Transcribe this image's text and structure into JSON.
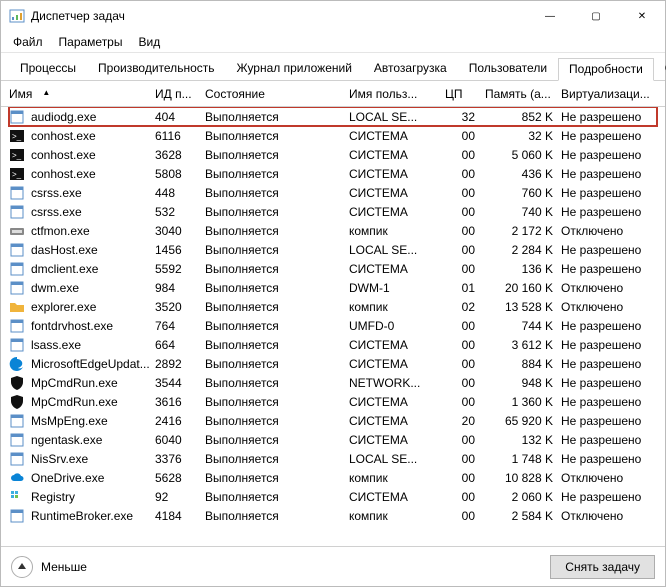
{
  "window": {
    "title": "Диспетчер задач",
    "controls": {
      "min": "—",
      "max": "▢",
      "close": "✕"
    }
  },
  "menu": {
    "items": [
      "Файл",
      "Параметры",
      "Вид"
    ]
  },
  "tabs": {
    "items": [
      "Процессы",
      "Производительность",
      "Журнал приложений",
      "Автозагрузка",
      "Пользователи",
      "Подробности",
      "Службы"
    ],
    "active_index": 5
  },
  "columns": {
    "name": "Имя",
    "pid": "ИД п...",
    "state": "Состояние",
    "user": "Имя польз...",
    "cpu": "ЦП",
    "mem": "Память (а...",
    "virt": "Виртуализаци..."
  },
  "rows": [
    {
      "icon": "app",
      "name": "audiodg.exe",
      "pid": "404",
      "state": "Выполняется",
      "user": "LOCAL SE...",
      "cpu": "32",
      "mem": "852 K",
      "virt": "Не разрешено",
      "hl": true
    },
    {
      "icon": "cmd",
      "name": "conhost.exe",
      "pid": "6116",
      "state": "Выполняется",
      "user": "СИСТЕМА",
      "cpu": "00",
      "mem": "32 K",
      "virt": "Не разрешено"
    },
    {
      "icon": "cmd",
      "name": "conhost.exe",
      "pid": "3628",
      "state": "Выполняется",
      "user": "СИСТЕМА",
      "cpu": "00",
      "mem": "5 060 K",
      "virt": "Не разрешено"
    },
    {
      "icon": "cmd",
      "name": "conhost.exe",
      "pid": "5808",
      "state": "Выполняется",
      "user": "СИСТЕМА",
      "cpu": "00",
      "mem": "436 K",
      "virt": "Не разрешено"
    },
    {
      "icon": "app",
      "name": "csrss.exe",
      "pid": "448",
      "state": "Выполняется",
      "user": "СИСТЕМА",
      "cpu": "00",
      "mem": "760 K",
      "virt": "Не разрешено"
    },
    {
      "icon": "app",
      "name": "csrss.exe",
      "pid": "532",
      "state": "Выполняется",
      "user": "СИСТЕМА",
      "cpu": "00",
      "mem": "740 K",
      "virt": "Не разрешено"
    },
    {
      "icon": "keyb",
      "name": "ctfmon.exe",
      "pid": "3040",
      "state": "Выполняется",
      "user": "компик",
      "cpu": "00",
      "mem": "2 172 K",
      "virt": "Отключено"
    },
    {
      "icon": "app",
      "name": "dasHost.exe",
      "pid": "1456",
      "state": "Выполняется",
      "user": "LOCAL SE...",
      "cpu": "00",
      "mem": "2 284 K",
      "virt": "Не разрешено"
    },
    {
      "icon": "app",
      "name": "dmclient.exe",
      "pid": "5592",
      "state": "Выполняется",
      "user": "СИСТЕМА",
      "cpu": "00",
      "mem": "136 K",
      "virt": "Не разрешено"
    },
    {
      "icon": "app",
      "name": "dwm.exe",
      "pid": "984",
      "state": "Выполняется",
      "user": "DWM-1",
      "cpu": "01",
      "mem": "20 160 K",
      "virt": "Отключено"
    },
    {
      "icon": "folder",
      "name": "explorer.exe",
      "pid": "3520",
      "state": "Выполняется",
      "user": "компик",
      "cpu": "02",
      "mem": "13 528 K",
      "virt": "Отключено"
    },
    {
      "icon": "app",
      "name": "fontdrvhost.exe",
      "pid": "764",
      "state": "Выполняется",
      "user": "UMFD-0",
      "cpu": "00",
      "mem": "744 K",
      "virt": "Не разрешено"
    },
    {
      "icon": "app",
      "name": "lsass.exe",
      "pid": "664",
      "state": "Выполняется",
      "user": "СИСТЕМА",
      "cpu": "00",
      "mem": "3 612 K",
      "virt": "Не разрешено"
    },
    {
      "icon": "edge",
      "name": "MicrosoftEdgeUpdat...",
      "pid": "2892",
      "state": "Выполняется",
      "user": "СИСТЕМА",
      "cpu": "00",
      "mem": "884 K",
      "virt": "Не разрешено"
    },
    {
      "icon": "shield",
      "name": "MpCmdRun.exe",
      "pid": "3544",
      "state": "Выполняется",
      "user": "NETWORK...",
      "cpu": "00",
      "mem": "948 K",
      "virt": "Не разрешено"
    },
    {
      "icon": "shield",
      "name": "MpCmdRun.exe",
      "pid": "3616",
      "state": "Выполняется",
      "user": "СИСТЕМА",
      "cpu": "00",
      "mem": "1 360 K",
      "virt": "Не разрешено"
    },
    {
      "icon": "app",
      "name": "MsMpEng.exe",
      "pid": "2416",
      "state": "Выполняется",
      "user": "СИСТЕМА",
      "cpu": "20",
      "mem": "65 920 K",
      "virt": "Не разрешено"
    },
    {
      "icon": "app",
      "name": "ngentask.exe",
      "pid": "6040",
      "state": "Выполняется",
      "user": "СИСТЕМА",
      "cpu": "00",
      "mem": "132 K",
      "virt": "Не разрешено"
    },
    {
      "icon": "app",
      "name": "NisSrv.exe",
      "pid": "3376",
      "state": "Выполняется",
      "user": "LOCAL SE...",
      "cpu": "00",
      "mem": "1 748 K",
      "virt": "Не разрешено"
    },
    {
      "icon": "cloud",
      "name": "OneDrive.exe",
      "pid": "5628",
      "state": "Выполняется",
      "user": "компик",
      "cpu": "00",
      "mem": "10 828 K",
      "virt": "Отключено"
    },
    {
      "icon": "reg",
      "name": "Registry",
      "pid": "92",
      "state": "Выполняется",
      "user": "СИСТЕМА",
      "cpu": "00",
      "mem": "2 060 K",
      "virt": "Не разрешено"
    },
    {
      "icon": "app",
      "name": "RuntimeBroker.exe",
      "pid": "4184",
      "state": "Выполняется",
      "user": "компик",
      "cpu": "00",
      "mem": "2 584 K",
      "virt": "Отключено"
    }
  ],
  "footer": {
    "less": "Меньше",
    "end_task": "Снять задачу"
  }
}
